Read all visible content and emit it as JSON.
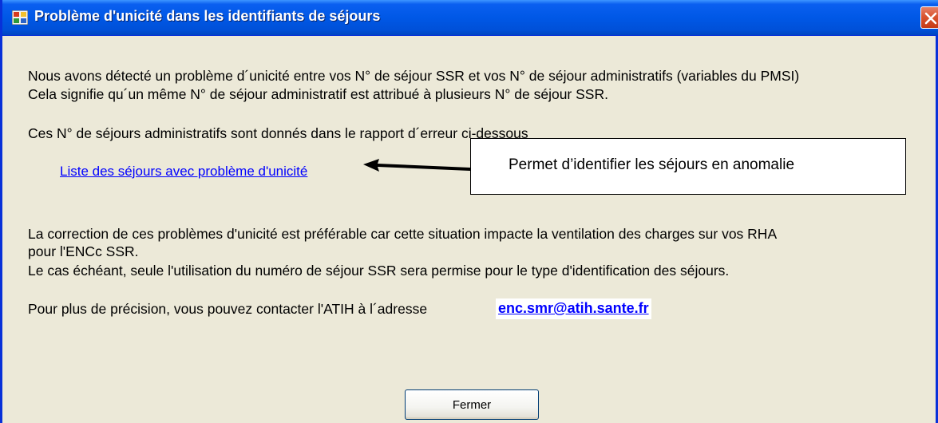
{
  "window": {
    "title": "Problème d'unicité dans les identifiants de séjours",
    "close_icon": "close-icon"
  },
  "message": {
    "line1": "Nous avons détecté un problème d´unicité entre vos N° de séjour SSR et vos N° de séjour administratifs (variables du PMSI)",
    "line2": "Cela signifie qu´un même N° de séjour administratif est attribué à plusieurs N° de séjour SSR.",
    "line3": "Ces N° de séjours administratifs sont donnés dans le rapport d´erreur ci-dessous",
    "link_label": "Liste des séjours avec problème d'unicité",
    "line4": "La correction de ces problèmes d'unicité est préférable car cette situation impacte la ventilation des charges sur vos RHA",
    "line5": "pour l'ENCc SSR.",
    "line6": "Le cas échéant, seule l'utilisation du numéro de séjour SSR sera permise pour le type d'identification des séjours.",
    "line7": "Pour plus de précision, vous pouvez contacter l'ATIH à l´adresse",
    "email": "enc.smr@atih.sante.fr"
  },
  "annotation": {
    "callout_text": "Permet d’identifier les séjours en anomalie"
  },
  "buttons": {
    "close_label": "Fermer"
  }
}
